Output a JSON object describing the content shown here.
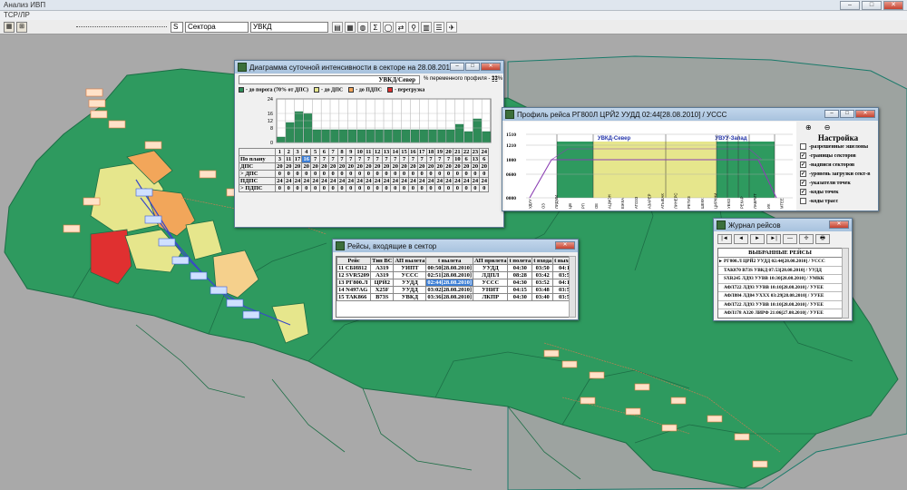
{
  "app": {
    "title": "Анализ ИВП",
    "menu": "ТСР/ЛР",
    "sector_label": "S",
    "sector_kind": "Сектора",
    "sector_value": "УВКД"
  },
  "daily_window": {
    "title": "Диаграмма суточной интенсивности в секторе на 28.08.2010",
    "sector": "УВКД/Север",
    "variable_profile": "% переменного профиля - 33%",
    "legend": [
      "- до порога (70% от ДПС)",
      "- до ДПС",
      "- до ПДПС",
      "- перегрузка"
    ],
    "legend_colors": [
      "#2e8b57",
      "#e6e68c",
      "#f2a65a",
      "#e03030"
    ],
    "y_ticks": [
      "24",
      "16",
      "12",
      "8",
      "0"
    ],
    "hours": [
      "1",
      "2",
      "3",
      "4",
      "5",
      "6",
      "7",
      "8",
      "9",
      "10",
      "11",
      "12",
      "13",
      "14",
      "15",
      "16",
      "17",
      "18",
      "19",
      "20",
      "21",
      "22",
      "23",
      "24"
    ],
    "rows": [
      {
        "label": "По плану",
        "values": [
          "3",
          "11",
          "17",
          "16",
          "7",
          "7",
          "7",
          "7",
          "7",
          "7",
          "7",
          "7",
          "7",
          "7",
          "7",
          "7",
          "7",
          "7",
          "7",
          "7",
          "10",
          "6",
          "13",
          "6"
        ]
      },
      {
        "label": "ДПС",
        "values": [
          "20",
          "20",
          "20",
          "20",
          "20",
          "20",
          "20",
          "20",
          "20",
          "20",
          "20",
          "20",
          "20",
          "20",
          "20",
          "20",
          "20",
          "20",
          "20",
          "20",
          "20",
          "20",
          "20",
          "20"
        ]
      },
      {
        "label": "> ДПС",
        "values": [
          "0",
          "0",
          "0",
          "0",
          "0",
          "0",
          "0",
          "0",
          "0",
          "0",
          "0",
          "0",
          "0",
          "0",
          "0",
          "0",
          "0",
          "0",
          "0",
          "0",
          "0",
          "0",
          "0",
          "0"
        ]
      },
      {
        "label": "ПДПС",
        "values": [
          "24",
          "24",
          "24",
          "24",
          "24",
          "24",
          "24",
          "24",
          "24",
          "24",
          "24",
          "24",
          "24",
          "24",
          "24",
          "24",
          "24",
          "24",
          "24",
          "24",
          "24",
          "24",
          "24",
          "24"
        ]
      },
      {
        "label": "> ПДПС",
        "values": [
          "0",
          "0",
          "0",
          "0",
          "0",
          "0",
          "0",
          "0",
          "0",
          "0",
          "0",
          "0",
          "0",
          "0",
          "0",
          "0",
          "0",
          "0",
          "0",
          "0",
          "0",
          "0",
          "0",
          "0"
        ]
      }
    ]
  },
  "chart_data": {
    "type": "bar",
    "categories": [
      "1",
      "2",
      "3",
      "4",
      "5",
      "6",
      "7",
      "8",
      "9",
      "10",
      "11",
      "12",
      "13",
      "14",
      "15",
      "16",
      "17",
      "18",
      "19",
      "20",
      "21",
      "22",
      "23",
      "24"
    ],
    "values": [
      3,
      11,
      17,
      16,
      7,
      7,
      7,
      7,
      7,
      7,
      7,
      7,
      7,
      7,
      7,
      7,
      7,
      7,
      7,
      7,
      10,
      6,
      13,
      6
    ],
    "ylim": [
      0,
      24
    ],
    "y_ticks": [
      0,
      8,
      12,
      16,
      24
    ]
  },
  "profile_window": {
    "title": "Профиль рейса РГ800Л  ЦРЙ2  УУДД 02:44[28.08.2010] / УССС",
    "sector_left": "УВКД-Север",
    "sector_right": "УВУУ-Запад",
    "y_ticks": [
      "1510",
      "1210",
      "1000",
      "0600",
      "0000"
    ],
    "x_labels": [
      "УДУУ",
      "ОЗ",
      "ЛИДМИ",
      "ЦВ",
      "РП",
      "ОЕ",
      "АЦМОН",
      "ЕЖКА",
      "АТОЗЗ",
      "АЗАРЕР",
      "АТЫЕАК",
      "ЛИНЕРС",
      "РЕТИЗ",
      "ШЕКК",
      "ЦИРКНИ",
      "УЕКО",
      "РЕКАР",
      "ЛАВРИТ",
      "ИК",
      "МТЕЕ"
    ],
    "settings_title": "Настройка",
    "settings": [
      {
        "label": "-разрешенные эшелоны",
        "checked": false
      },
      {
        "label": "-границы секторов",
        "checked": true
      },
      {
        "label": "-надписи секторов",
        "checked": true
      },
      {
        "label": "-уровень загрузки сект-в",
        "checked": true
      },
      {
        "label": "-указатели точек",
        "checked": true
      },
      {
        "label": "-коды точек",
        "checked": true
      },
      {
        "label": "-коды трасс",
        "checked": false
      }
    ]
  },
  "flights_window": {
    "title": "Рейсы, входящие в сектор",
    "headers": [
      "Рейс",
      "Тип ВС",
      "АП вылета",
      "t вылета",
      "АП прилета",
      "t полета",
      "t входа",
      "t выхода"
    ],
    "rows": [
      [
        "11 СБИ812",
        "A319",
        "УИПТ",
        "00:50[28.08.2010]",
        "УУДД",
        "04:30",
        "03:50",
        "04:13"
      ],
      [
        "12 SVR5209",
        "A319",
        "УССС",
        "02:51[28.08.2010]",
        "ЛДПЛ",
        "08:28",
        "03:42",
        "03:51"
      ],
      [
        "13 РГ800.Л",
        "ЦРЙ2",
        "УУДД",
        "02:44[28.08.2010]",
        "УССС",
        "04:30",
        "03:52",
        "04:14"
      ],
      [
        "14 N497AG",
        "X25F",
        "УУДД",
        "03:02[28.08.2010]",
        "УНИТ",
        "04:15",
        "03:48",
        "03:56"
      ],
      [
        "15 TAK866",
        "B73S",
        "УВКД",
        "03:36[28.08.2010]",
        "ЛКПР",
        "04:30",
        "03:40",
        "03:58"
      ]
    ],
    "selected_row": 2
  },
  "journal_window": {
    "title": "Журнал рейсов",
    "nav": [
      "|◄",
      "◄",
      "►",
      "►|",
      "—",
      "✢",
      "🖶"
    ],
    "header": "ВЫБРАННЫЕ РЕЙСЫ",
    "rows": [
      "РГ800.Л  ЦРЙ2  УУДД 02:44[28.08.2010] / УССС",
      "ТАК870  B73S  УВКД 07:53[28.08.2010] / УУДД",
      "SXR245  ЛД93  УУВВ 10:30[28.08.2010] / УМКК",
      "АФЛ722  ЛД93  УУВВ 10:10[28.08.2010] / УУЕЕ",
      "АФЛ884  ЛД84  УХХХ 03:29[28.08.2010] / УУЕЕ",
      "АФЛ722  ЛД93  УУВВ 10:10[28.08.2010] / УУЕЕ",
      "АФЛ178  A320  ЛИРФ 21:06[27.08.2010] / УУЕЕ"
    ]
  }
}
